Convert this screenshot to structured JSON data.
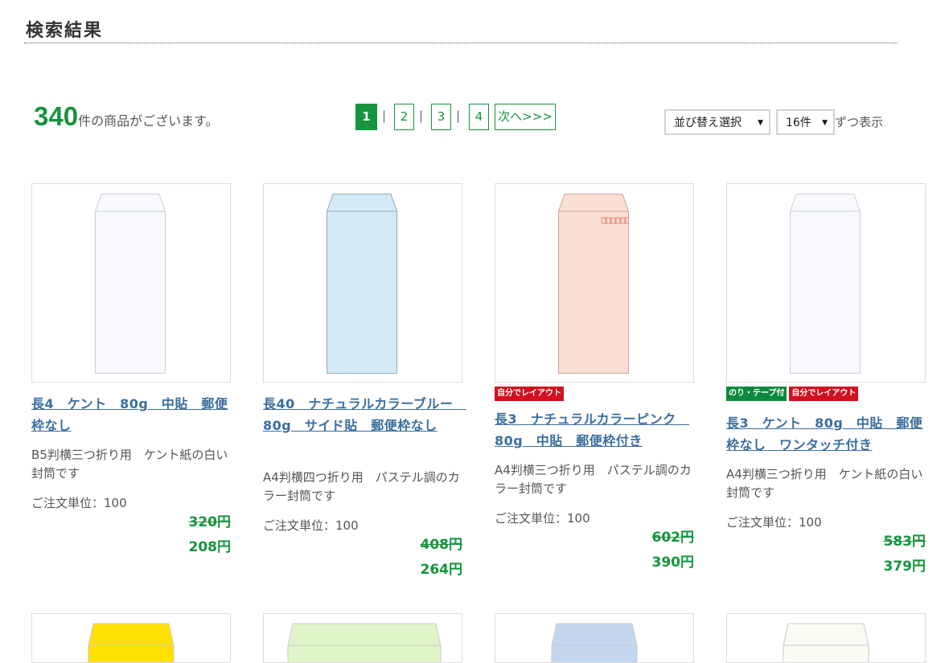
{
  "header": {
    "title": "検索結果"
  },
  "results": {
    "count": "340",
    "count_suffix": "件の商品がございます。"
  },
  "pagination": {
    "pages": [
      "1",
      "2",
      "3",
      "4"
    ],
    "current": "1",
    "separator": "|",
    "next_label": "次へ>>>"
  },
  "sort": {
    "sort_select": "並び替え選択",
    "per_page_select": "16件",
    "per_page_suffix": "ずつ表示"
  },
  "products": [
    {
      "name": "長4　ケント　80g　中貼　郵便枠なし",
      "badges": [],
      "description": "B5判横三つ折り用　ケント紙の白い封筒です",
      "unit": "ご注文単位：100",
      "old_price": "320円",
      "price": "208円",
      "color": "#f8f9fc"
    },
    {
      "name": "長40　ナチュラルカラーブルー　80g　サイド貼　郵便枠なし",
      "badges": [],
      "description": "A4判横四つ折り用　パステル調のカラー封筒です",
      "unit": "ご注文単位：100",
      "old_price": "408円",
      "price": "264円",
      "color": "#d4ebf7"
    },
    {
      "name": "長3　ナチュラルカラーピンク　80g　中貼　郵便枠付き",
      "badges": [
        {
          "text": "自分でレイアウト",
          "color": "#d3101e"
        }
      ],
      "description": "A4判横三つ折り用　パステル調のカラー封筒です",
      "unit": "ご注文単位：100",
      "old_price": "602円",
      "price": "390円",
      "color": "#fadfd4"
    },
    {
      "name": "長3　ケント　80g　中貼　郵便枠なし　ワンタッチ付き",
      "badges": [
        {
          "text": "のり・テープ付",
          "color": "#0a8a3c"
        },
        {
          "text": "自分でレイアウト",
          "color": "#d3101e"
        }
      ],
      "description": "A4判横三つ折り用　ケント紙の白い封筒です",
      "unit": "ご注文単位：100",
      "old_price": "583円",
      "price": "379円",
      "color": "#f8f9fc"
    }
  ],
  "next_row_colors": [
    "#ffe100",
    "#dff5c8",
    "#c3d6ee",
    "#fbfaf2"
  ],
  "colors": {
    "accent": "#16943e",
    "link": "#3a6e9e"
  }
}
